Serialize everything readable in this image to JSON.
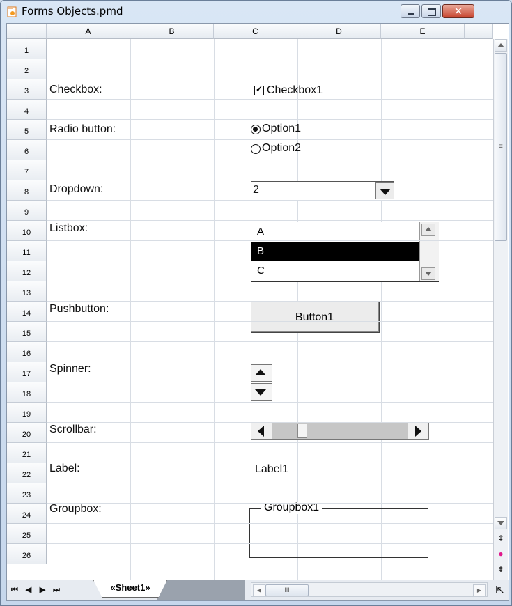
{
  "window": {
    "title": "Forms Objects.pmd",
    "icon": "document-app-icon"
  },
  "columns": [
    "A",
    "B",
    "C",
    "D",
    "E"
  ],
  "rows": [
    "1",
    "2",
    "3",
    "4",
    "5",
    "6",
    "7",
    "8",
    "9",
    "10",
    "11",
    "12",
    "13",
    "14",
    "15",
    "16",
    "17",
    "18",
    "19",
    "20",
    "21",
    "22",
    "23",
    "24",
    "25",
    "26"
  ],
  "labels": {
    "checkbox": "Checkbox:",
    "radio": "Radio button:",
    "dropdown": "Dropdown:",
    "listbox": "Listbox:",
    "pushbutton": "Pushbutton:",
    "spinner": "Spinner:",
    "scrollbar": "Scrollbar:",
    "label": "Label:",
    "groupbox": "Groupbox:"
  },
  "controls": {
    "checkbox_label": "Checkbox1",
    "checkbox_checked": true,
    "radio_options": [
      {
        "label": "Option1",
        "selected": true
      },
      {
        "label": "Option2",
        "selected": false
      }
    ],
    "dropdown_value": "2",
    "listbox_items": [
      {
        "label": "A",
        "selected": false
      },
      {
        "label": "B",
        "selected": true
      },
      {
        "label": "C",
        "selected": false
      }
    ],
    "button_label": "Button1",
    "scrollbar_value": 0.2,
    "label_text": "Label1",
    "groupbox_label": "Groupbox1"
  },
  "sheet": {
    "tab_label": "«Sheet1»",
    "scroll_label": "III"
  },
  "colors": {
    "selection_bg": "#000000",
    "grid_line": "#d8dde4",
    "header_bg": "#f0f3f7"
  }
}
